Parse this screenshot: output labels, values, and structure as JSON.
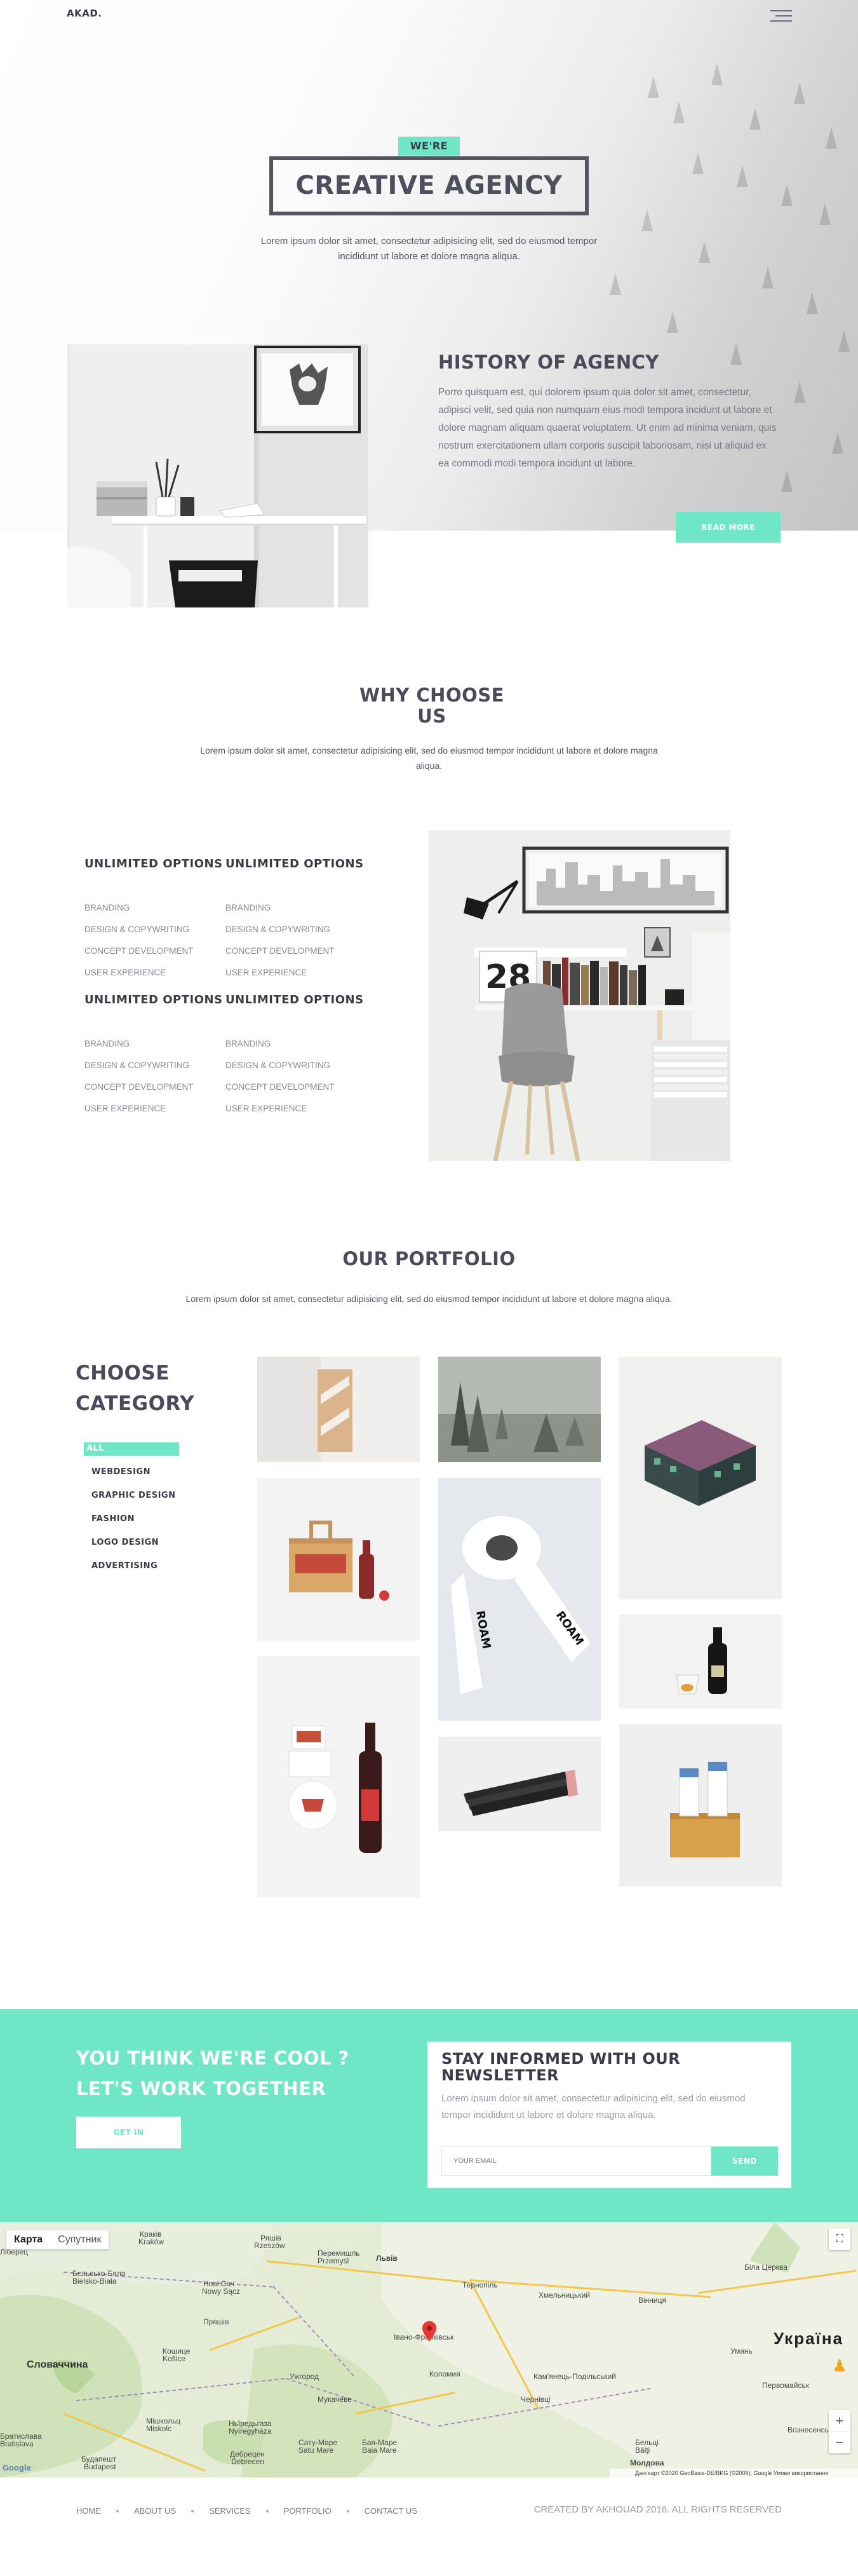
{
  "header": {
    "logo": "AKAD."
  },
  "hero": {
    "badge": "WE'RE",
    "title": "CREATIVE AGENCY",
    "text": "Lorem ipsum dolor sit amet, consectetur adipisicing elit, sed do eiusmod tempor incididunt ut labore et dolore magna aliqua."
  },
  "history": {
    "title": "HISTORY OF AGENCY",
    "text": "Porro quisquam est, qui dolorem ipsum quia dolor sit amet, consectetur, adipisci velit, sed quia non numquam eius modi tempora incidunt ut labore et dolore magnam aliquam quaerat voluptatem. Ut enim ad minima veniam, quis nostrum exercitationem ullam corporis suscipit laboriosam, nisi ut aliquid ex ea commodi modi tempora incidunt ut labore.",
    "button": "READ MORE"
  },
  "why": {
    "title_line1": "WHY CHOOSE",
    "title_line2": "US",
    "text": "Lorem ipsum dolor sit amet, consectetur adipisicing elit, sed do eiusmod tempor incididunt ut labore et dolore magna aliqua.",
    "options": [
      {
        "heading": "UNLIMITED OPTIONS",
        "items": [
          "BRANDING",
          "DESIGN & COPYWRITING",
          "CONCEPT DEVELOPMENT",
          "USER EXPERIENCE"
        ]
      },
      {
        "heading": "UNLIMITED OPTIONS",
        "items": [
          "BRANDING",
          "DESIGN & COPYWRITING",
          "CONCEPT DEVELOPMENT",
          "USER EXPERIENCE"
        ]
      },
      {
        "heading": "UNLIMITED OPTIONS",
        "items": [
          "BRANDING",
          "DESIGN & COPYWRITING",
          "CONCEPT DEVELOPMENT",
          "USER EXPERIENCE"
        ]
      },
      {
        "heading": "UNLIMITED OPTIONS",
        "items": [
          "BRANDING",
          "DESIGN & COPYWRITING",
          "CONCEPT DEVELOPMENT",
          "USER EXPERIENCE"
        ]
      }
    ],
    "calendar_number": "28"
  },
  "portfolio": {
    "title": "OUR PORTFOLIO",
    "text": "Lorem ipsum dolor sit amet, consectetur adipisicing elit, sed do eiusmod tempor incididunt ut labore et dolore magna aliqua.",
    "category_title_line1": "CHOOSE",
    "category_title_line2": "CATEGORY",
    "categories": [
      "ALL",
      "WEBDESIGN",
      "GRAPHIC DESIGN",
      "FASHION",
      "LOGO DESIGN",
      "ADVERTISING"
    ],
    "tape_text": "ROAM"
  },
  "cta": {
    "line1": "YOU THINK WE'RE COOL ?",
    "line2": "LET'S WORK TOGETHER",
    "button": "GET IN"
  },
  "newsletter": {
    "title": "STAY INFORMED WITH OUR NEWSLETTER",
    "text": "Lorem ipsum dolor sit amet, consectetur adipisicing elit, sed do eiusmod tempor incididunt ut labore et dolore magna aliqua.",
    "placeholder": "YOUR EMAIL",
    "button": "SEND"
  },
  "map": {
    "tab_map": "Карта",
    "tab_satellite": "Супутник",
    "country_label": "Україна",
    "attribution": "Дані карт ©2020 GeoBasis-DE/BKG (©2009), Google   Умови використання",
    "google": "Google",
    "labels": [
      "Краків",
      "Kraków",
      "Ряшів",
      "Rzeszów",
      "Перемишль",
      "Przemyśl",
      "Львів",
      "Тернопіль",
      "Хмельницький",
      "Вінниця",
      "Біла Церква",
      "Словаччина",
      "Кошице",
      "Košice",
      "Ужгород",
      "Мукачеве",
      "Івано-Франківськ",
      "Коломия",
      "Чернівці",
      "Будапешт",
      "Budapest",
      "Молдова",
      "Умань",
      "Нові Сач",
      "Nowy Sącz",
      "Пряшів",
      "Мішкольц",
      "Miskolc",
      "Дебрецен",
      "Debrecen",
      "Сату-Маре",
      "Satu Mare",
      "Бая-Маре",
      "Baia Mare",
      "Ньїредьгаза",
      "Nyíregyháza",
      "Братислава",
      "Bratislava",
      "Кам'янець-Подільський",
      "Бєльсько-Бяла",
      "Bielsko-Biała",
      "Ліберец",
      "Бельці",
      "Bălți",
      "Первомайськ",
      "Вознесенськ"
    ]
  },
  "footer": {
    "nav": [
      "HOME",
      "ABOUT US",
      "SERVICES",
      "PORTFOLIO",
      "CONTACT US"
    ],
    "copyright": "CREATED BY AKHOUAD 2016. ALL RIGHTS RESERVED"
  }
}
